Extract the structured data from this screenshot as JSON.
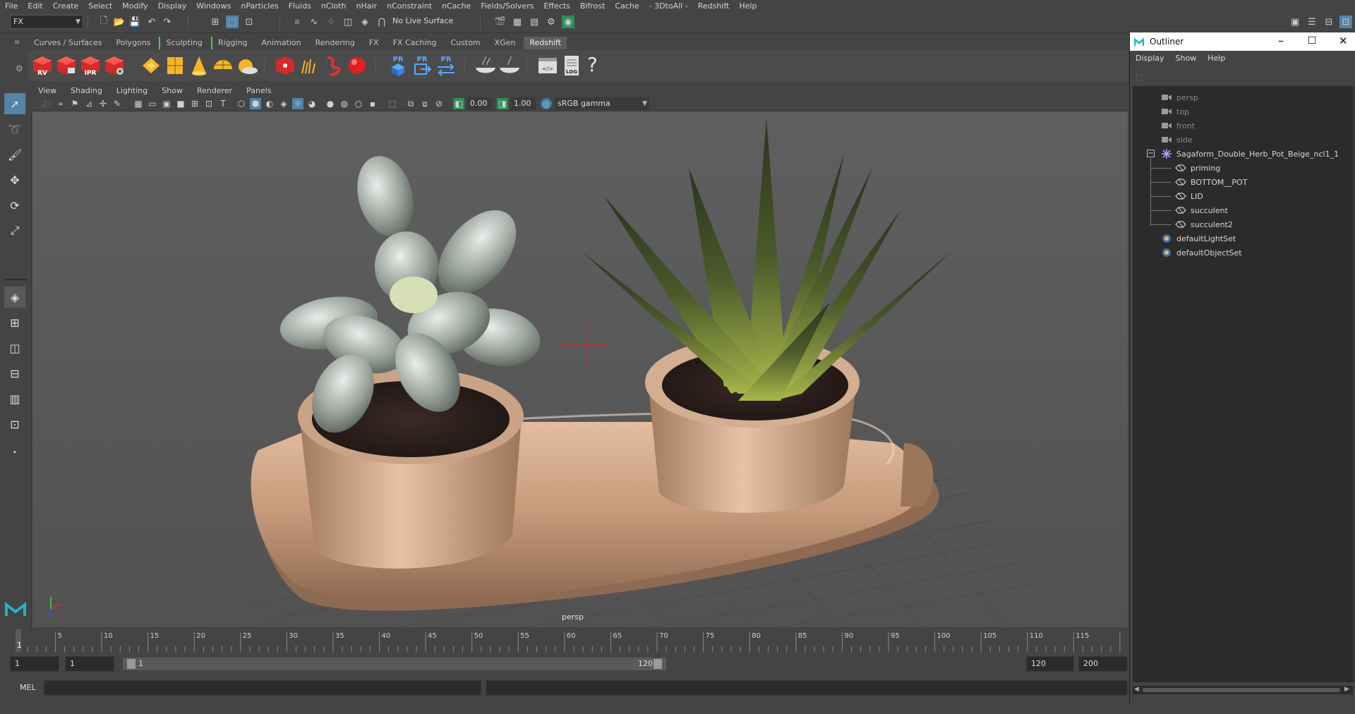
{
  "menubar": [
    "File",
    "Edit",
    "Create",
    "Select",
    "Modify",
    "Display",
    "Windows",
    "nParticles",
    "Fluids",
    "nCloth",
    "nHair",
    "nConstraint",
    "nCache",
    "Fields/Solvers",
    "Effects",
    "Bifrost",
    "Cache",
    "- 3DtoAll -",
    "Redshift",
    "Help"
  ],
  "statusline": {
    "mode": "FX",
    "live_surface": "No Live Surface"
  },
  "shelf_tabs": [
    {
      "label": "Curves / Surfaces",
      "active": false,
      "mark": false
    },
    {
      "label": "Polygons",
      "active": false,
      "mark": false
    },
    {
      "label": "Sculpting",
      "active": false,
      "mark": true
    },
    {
      "label": "Rigging",
      "active": false,
      "mark": true
    },
    {
      "label": "Animation",
      "active": false,
      "mark": false
    },
    {
      "label": "Rendering",
      "active": false,
      "mark": false
    },
    {
      "label": "FX",
      "active": false,
      "mark": false
    },
    {
      "label": "FX Caching",
      "active": false,
      "mark": false
    },
    {
      "label": "Custom",
      "active": false,
      "mark": false
    },
    {
      "label": "XGen",
      "active": false,
      "mark": false
    },
    {
      "label": "Redshift",
      "active": true,
      "mark": false
    }
  ],
  "shelf": {
    "rs_labels": [
      "RV",
      "",
      "IPR",
      ""
    ],
    "pr_labels": [
      "PR",
      "PR",
      "PR"
    ],
    "log_label": "LOG",
    "help": "?"
  },
  "panel_menu": [
    "View",
    "Shading",
    "Lighting",
    "Show",
    "Renderer",
    "Panels"
  ],
  "viewport_toolbar": {
    "exposure": "0.00",
    "gamma": "1.00",
    "color_space": "sRGB gamma"
  },
  "viewport": {
    "camera_label": "persp"
  },
  "timeline": {
    "ticks": [
      "5",
      "10",
      "15",
      "20",
      "25",
      "30",
      "35",
      "40",
      "45",
      "50",
      "55",
      "60",
      "65",
      "70",
      "75",
      "80",
      "85",
      "90",
      "95",
      "100",
      "105",
      "110",
      "115"
    ],
    "current_frame": "1",
    "current_frame_fraction": 0.0
  },
  "range": {
    "start_frame": "1",
    "playback_start": "1",
    "slider_start": "1",
    "slider_end": "120",
    "playback_end": "120",
    "end_frame": "200"
  },
  "command": {
    "language": "MEL"
  },
  "outliner": {
    "title": "Outliner",
    "menu": [
      "Display",
      "Show",
      "Help"
    ],
    "items": [
      {
        "label": "persp",
        "icon": "camera-icon",
        "dim": true,
        "indent": 1
      },
      {
        "label": "top",
        "icon": "camera-icon",
        "dim": true,
        "indent": 1
      },
      {
        "label": "front",
        "icon": "camera-icon",
        "dim": true,
        "indent": 1
      },
      {
        "label": "side",
        "icon": "camera-icon",
        "dim": true,
        "indent": 1
      },
      {
        "label": "Sagaform_Double_Herb_Pot_Beige_ncl1_1",
        "icon": "group-asterisk-icon",
        "dim": false,
        "indent": 1
      },
      {
        "label": "priming",
        "icon": "mesh-icon",
        "dim": false,
        "indent": 2
      },
      {
        "label": "BOTTOM__POT",
        "icon": "mesh-icon",
        "dim": false,
        "indent": 2
      },
      {
        "label": "LID",
        "icon": "mesh-icon",
        "dim": false,
        "indent": 2
      },
      {
        "label": "succulent",
        "icon": "mesh-icon",
        "dim": false,
        "indent": 2
      },
      {
        "label": "succulent2",
        "icon": "mesh-icon",
        "dim": false,
        "indent": 2
      },
      {
        "label": "defaultLightSet",
        "icon": "set-icon",
        "dim": false,
        "indent": 1
      },
      {
        "label": "defaultObjectSet",
        "icon": "set-icon",
        "dim": false,
        "indent": 1
      }
    ]
  },
  "colors": {
    "accent": "#5285a6",
    "shelf_mark": "#41d34a",
    "panel": "#444444",
    "field": "#2b2b2b"
  }
}
